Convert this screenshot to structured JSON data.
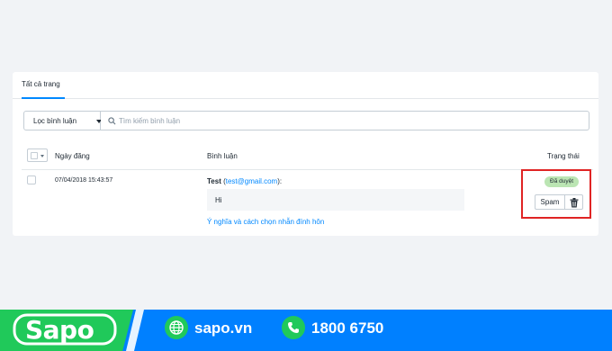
{
  "tabs": {
    "all_pages": "Tất cả trang"
  },
  "filters": {
    "filter_button": "Lọc bình luận",
    "search_placeholder": "Tìm kiếm bình luận"
  },
  "table": {
    "headers": {
      "date": "Ngày đăng",
      "comment": "Bình luận",
      "status": "Trạng thái"
    },
    "rows": [
      {
        "date": "07/04/2018 15:43:57",
        "author": "Test",
        "email": "test@gmail.com",
        "message": "Hi",
        "page_link": "Ý nghĩa và cách chọn nhẫn đính hôn",
        "status": "Đã duyệt",
        "spam_label": "Spam"
      }
    ]
  },
  "footer": {
    "brand": "Sapo",
    "website": "sapo.vn",
    "hotline": "1800 6750"
  },
  "colors": {
    "accent": "#0088ff",
    "status_approved_bg": "#bbe5b3",
    "highlight": "#e02424",
    "footer_green": "#20c95a",
    "footer_blue": "#0080ff"
  }
}
